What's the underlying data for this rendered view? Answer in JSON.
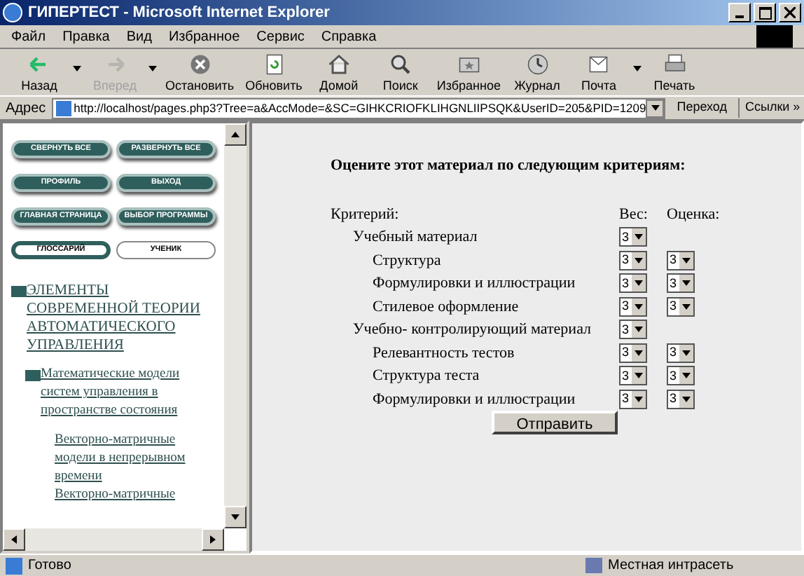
{
  "window": {
    "title": "ГИПЕРТЕСТ - Microsoft Internet Explorer"
  },
  "menu": [
    "Файл",
    "Правка",
    "Вид",
    "Избранное",
    "Сервис",
    "Справка"
  ],
  "toolbar": [
    {
      "label": "Назад",
      "kind": "back",
      "disabled": false,
      "dropdown": true
    },
    {
      "label": "Вперед",
      "kind": "forward",
      "disabled": true,
      "dropdown": true
    },
    {
      "label": "Остановить",
      "kind": "stop",
      "disabled": false,
      "dropdown": false
    },
    {
      "label": "Обновить",
      "kind": "refresh",
      "disabled": false,
      "dropdown": false
    },
    {
      "label": "Домой",
      "kind": "home",
      "disabled": false,
      "dropdown": false
    },
    {
      "label": "Поиск",
      "kind": "search",
      "disabled": false,
      "dropdown": false
    },
    {
      "label": "Избранное",
      "kind": "favorites",
      "disabled": false,
      "dropdown": false
    },
    {
      "label": "Журнал",
      "kind": "history",
      "disabled": false,
      "dropdown": false
    },
    {
      "label": "Почта",
      "kind": "mail",
      "disabled": false,
      "dropdown": true
    },
    {
      "label": "Печать",
      "kind": "print",
      "disabled": false,
      "dropdown": false
    }
  ],
  "address_bar": {
    "label": "Адрес",
    "value": "http://localhost/pages.php3?Tree=a&AccMode=&SC=GIHKCRIOFKLIHGNLIIPSQK&UserID=205&PID=1209",
    "go": "Переход",
    "links": "Ссылки »"
  },
  "sidebar": {
    "buttons": [
      {
        "label": "СВЕРНУТЬ ВСЕ",
        "kind": "filled"
      },
      {
        "label": "РАЗВЕРНУТЬ ВСЕ",
        "kind": "filled"
      },
      {
        "label": "ПРОФИЛЬ",
        "kind": "filled"
      },
      {
        "label": "ВЫХОД",
        "kind": "filled"
      },
      {
        "label": "ГЛАВНАЯ СТРАНИЦА",
        "kind": "filled"
      },
      {
        "label": "ВЫБОР ПРОГРАММЫ",
        "kind": "filled"
      },
      {
        "label": "ГЛОССАРИЙ",
        "kind": "ringed"
      },
      {
        "label": "УЧЕНИК",
        "kind": "outline"
      }
    ],
    "tree": [
      {
        "label": "ЭЛЕМЕНТЫ СОВРЕМЕННОЙ ТЕОРИИ АВТОМАТИЧЕСКОГО УПРАВЛЕНИЯ",
        "children": [
          {
            "label": "Математические модели систем управления в пространстве состояния",
            "children": [
              {
                "label": "Векторно-матричные модели в непрерывном времени"
              },
              {
                "label": "Векторно-матричные"
              }
            ]
          }
        ]
      }
    ]
  },
  "form": {
    "heading": "Оцените этот материал по следующим критериям:",
    "criteria_header": "Критерий:",
    "weight_header": "Вес:",
    "score_header": "Оценка:",
    "criteria": [
      {
        "label": "Учебный материал",
        "weight": "3",
        "children": [
          {
            "label": "Структура",
            "weight": "3",
            "score": "3"
          },
          {
            "label": "Формулировки и иллюстрации",
            "weight": "3",
            "score": "3"
          },
          {
            "label": "Стилевое оформление",
            "weight": "3",
            "score": "3"
          }
        ]
      },
      {
        "label": "Учебно- контролирующий материал",
        "weight": "3",
        "children": [
          {
            "label": "Релевантность тестов",
            "weight": "3",
            "score": "3"
          },
          {
            "label": "Структура теста",
            "weight": "3",
            "score": "3"
          },
          {
            "label": "Формулировки и иллюстрации",
            "weight": "3",
            "score": "3"
          }
        ]
      }
    ],
    "submit": "Отправить"
  },
  "status_bar": {
    "text": "Готово",
    "zone": "Местная интрасеть"
  }
}
